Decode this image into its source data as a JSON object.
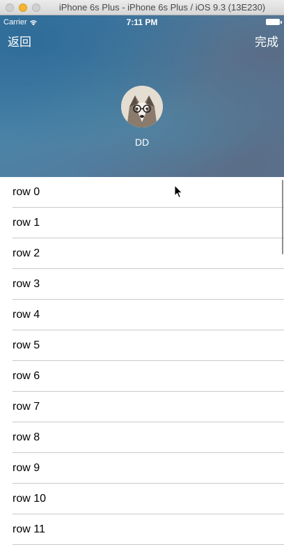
{
  "window": {
    "title": "iPhone 6s Plus - iPhone 6s Plus / iOS 9.3 (13E230)"
  },
  "status_bar": {
    "carrier": "Carrier",
    "time": "7:11 PM"
  },
  "nav": {
    "back_label": "返回",
    "done_label": "完成"
  },
  "profile": {
    "name": "DD"
  },
  "rows": [
    "row 0",
    "row 1",
    "row 2",
    "row 3",
    "row 4",
    "row 5",
    "row 6",
    "row 7",
    "row 8",
    "row 9",
    "row 10",
    "row 11"
  ],
  "icons": {
    "wifi": "wifi-icon",
    "battery": "battery-icon",
    "cursor": "mouse-pointer-icon"
  },
  "colors": {
    "header_blue": "#4580a6",
    "separator": "#c8c7cc",
    "text": "#000000"
  }
}
